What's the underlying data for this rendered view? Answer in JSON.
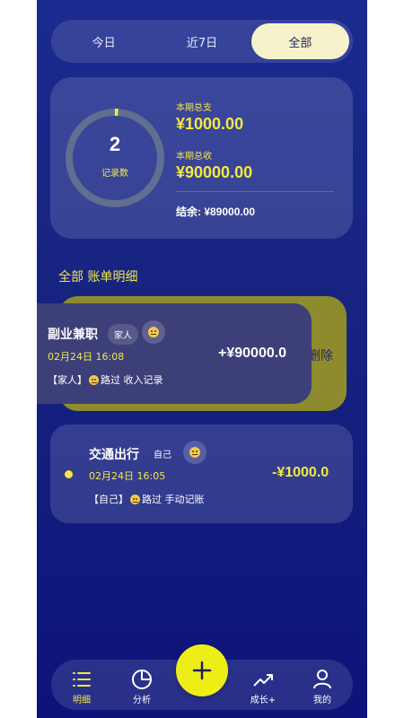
{
  "tabs": [
    {
      "label": "今日",
      "active": false
    },
    {
      "label": "近7日",
      "active": false
    },
    {
      "label": "全部",
      "active": true
    }
  ],
  "summary": {
    "record_count": "2",
    "record_count_label": "记录数",
    "expense_label": "本期总支",
    "expense_value": "¥1000.00",
    "income_label": "本期总收",
    "income_value": "¥90000.00",
    "balance_text": "结余: ¥89000.00",
    "ring_progress": 0.011
  },
  "section_title": "全部 账单明细",
  "records": [
    {
      "title": "副业兼职",
      "member": "家人",
      "mood_icon": "neutral-face-icon",
      "date": "02月24日 16:08",
      "amount": "+¥90000.0",
      "note_prefix": "【家人】",
      "note_suffix": "路过 收入记录",
      "delete_label": "删除"
    },
    {
      "title": "交通出行",
      "member": "自己",
      "mood_icon": "neutral-face-icon",
      "date": "02月24日 16:05",
      "amount": "-¥1000.0",
      "note_prefix": "【自己】",
      "note_suffix": "路过 手动记账"
    }
  ],
  "nav": {
    "items": [
      {
        "label": "明细",
        "icon": "list-icon",
        "active": true
      },
      {
        "label": "分析",
        "icon": "pie-chart-icon",
        "active": false
      },
      {
        "label": "成长+",
        "icon": "trend-up-icon",
        "active": false
      },
      {
        "label": "我的",
        "icon": "user-icon",
        "active": false
      }
    ],
    "add_icon": "plus-icon"
  },
  "colors": {
    "accent": "#f3ea3d",
    "income": "#ffffff",
    "expense": "#f3ea3d",
    "background": "#16237f"
  }
}
